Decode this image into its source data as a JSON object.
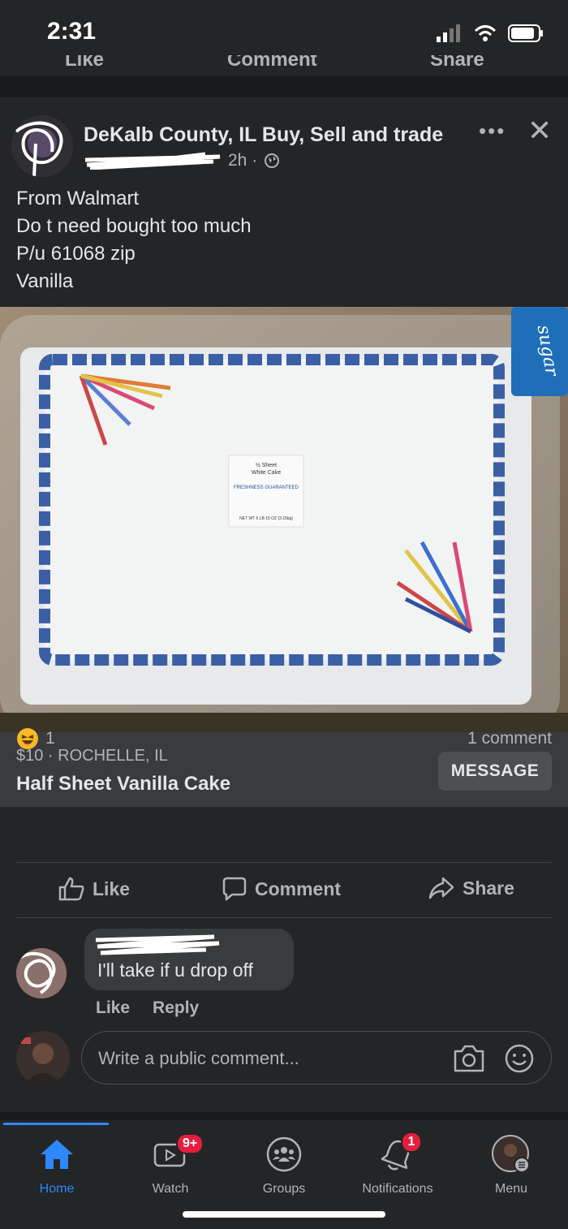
{
  "status": {
    "time": "2:31"
  },
  "prev_post_actions": [
    "Like",
    "Comment",
    "Share"
  ],
  "post": {
    "group_name": "DeKalb County, IL Buy, Sell and trade",
    "time_ago": "2h ·",
    "privacy_icon": "globe-icon",
    "lines": [
      "From Walmart",
      "Do t need bought too much",
      "P/u 61068 zip",
      "Vanilla"
    ],
    "photo_label": {
      "title": "½ Sheet",
      "subtitle": "White Cake",
      "brand": "FRESHNESS GUARANTEED",
      "weight": "NET WT 6 LB 15 OZ (3.15kg)"
    },
    "listing": {
      "meta": "$10 · ROCHELLE, IL",
      "title": "Half Sheet Vanilla Cake",
      "message_label": "MESSAGE"
    },
    "reaction_count": "1",
    "comment_count": "1 comment",
    "actions": {
      "like": "Like",
      "comment": "Comment",
      "share": "Share"
    }
  },
  "comment": {
    "text": "I'll take if u drop off",
    "like": "Like",
    "reply": "Reply"
  },
  "write_comment": {
    "placeholder": "Write a public comment..."
  },
  "tabs": [
    {
      "label": "Home",
      "active": true
    },
    {
      "label": "Watch",
      "badge": "9+"
    },
    {
      "label": "Groups"
    },
    {
      "label": "Notifications",
      "badge": "1"
    },
    {
      "label": "Menu"
    }
  ],
  "colors": {
    "accent": "#2d88ff",
    "badge": "#e41e3f",
    "bg": "#18191a",
    "card": "#242526"
  }
}
